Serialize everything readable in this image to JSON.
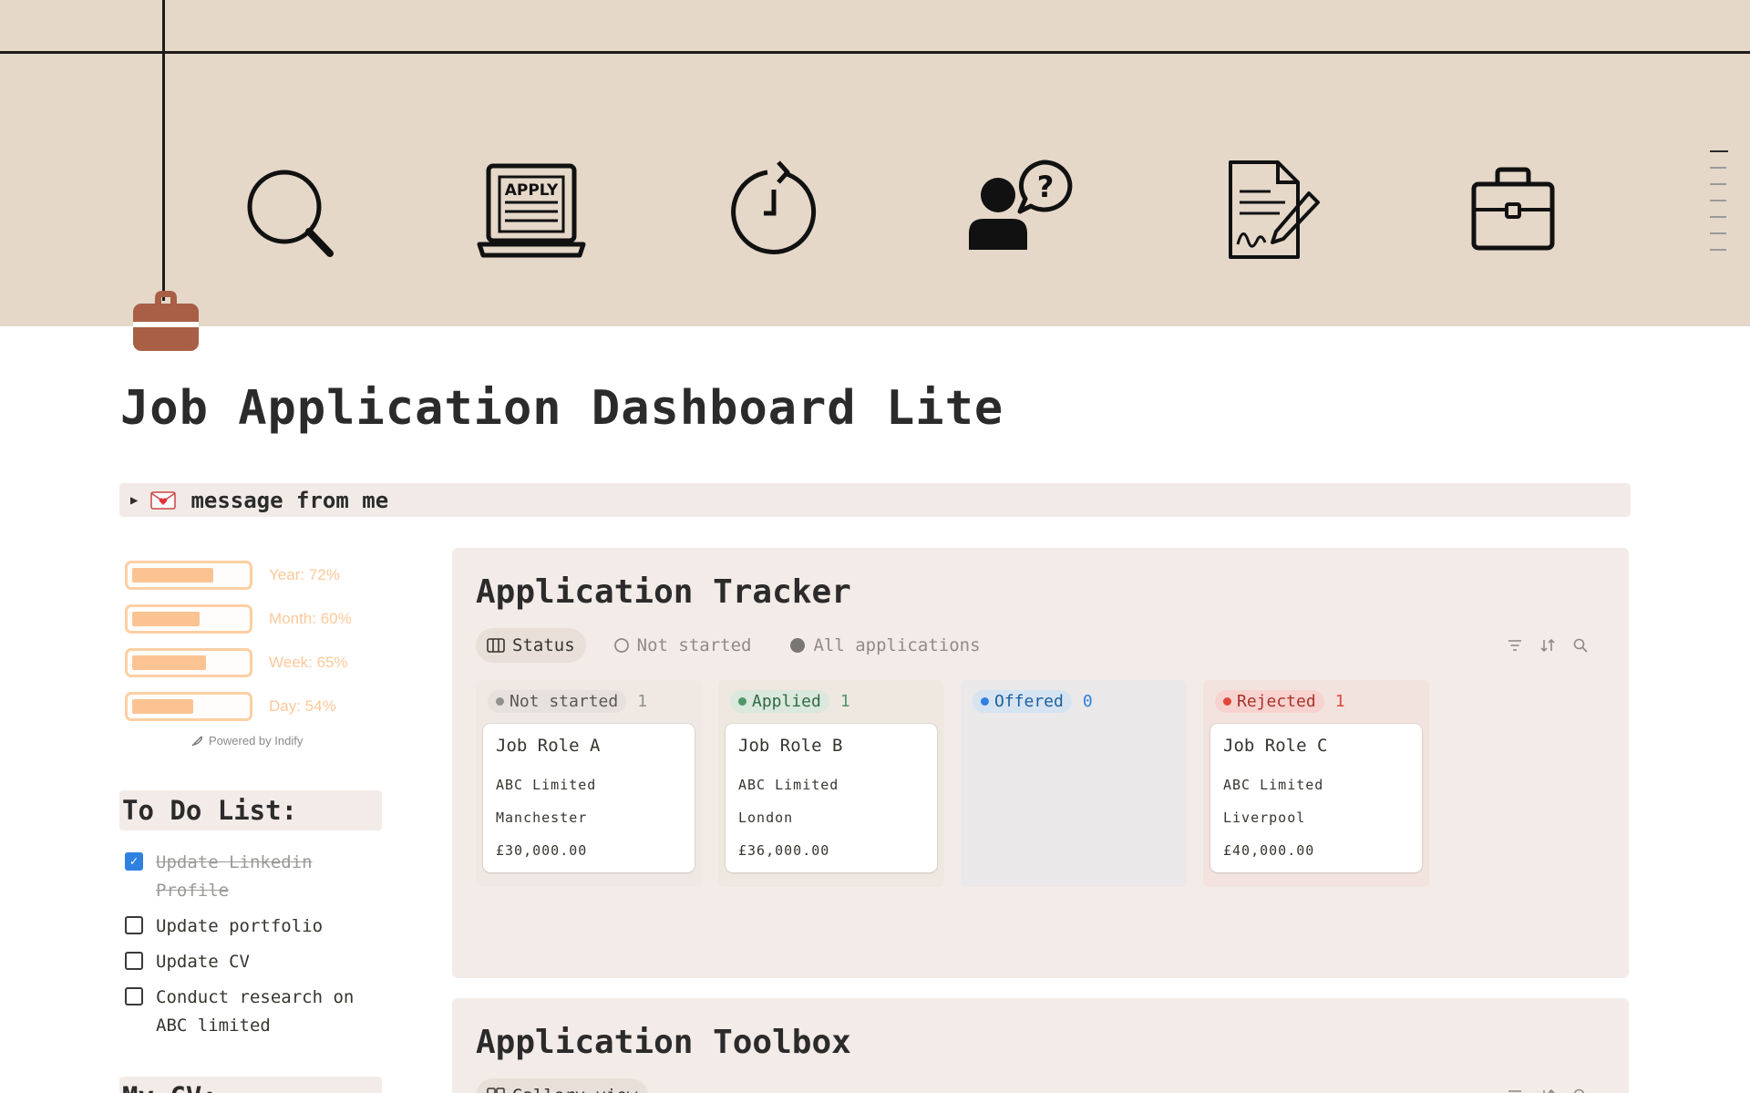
{
  "page": {
    "title": "Job Application Dashboard Lite",
    "toggle_label": "message from me"
  },
  "cover": {
    "background": "#e5d8c9",
    "icons": [
      "search-icon",
      "laptop-apply-icon",
      "clock-refresh-icon",
      "person-question-icon",
      "contract-sign-icon",
      "briefcase-icon"
    ],
    "apply_text": "APPLY"
  },
  "progress": {
    "bars": [
      {
        "label": "Year: 72%",
        "value": 0.72
      },
      {
        "label": "Month: 60%",
        "value": 0.6
      },
      {
        "label": "Week: 65%",
        "value": 0.65
      },
      {
        "label": "Day: 54%",
        "value": 0.54
      }
    ],
    "powered_by": "Powered by Indify",
    "color": "#fcc392"
  },
  "todo": {
    "heading": "To Do List:",
    "items": [
      {
        "text": "Update Linkedin Profile",
        "checked": true
      },
      {
        "text": "Update portfolio",
        "checked": false
      },
      {
        "text": "Update CV",
        "checked": false
      },
      {
        "text": "Conduct research on ABC limited",
        "checked": false
      }
    ]
  },
  "cv": {
    "heading": "My CV:"
  },
  "tracker": {
    "title": "Application Tracker",
    "views": [
      {
        "label": "Status",
        "active": true
      },
      {
        "label": "Not started",
        "active": false
      },
      {
        "label": "All applications",
        "active": false
      }
    ],
    "columns": [
      {
        "status": "Not started",
        "count": "1",
        "pill_bg": "#e6e1dd",
        "dot": "#91918e",
        "text": "#5a5855",
        "col_bg": "#efe8e3",
        "cards": [
          {
            "title": "Job Role A",
            "company": "ABC Limited",
            "location": "Manchester",
            "salary": "£30,000.00"
          }
        ]
      },
      {
        "status": "Applied",
        "count": "1",
        "pill_bg": "#dbe8dd",
        "dot": "#4f9768",
        "text": "#2f6b46",
        "col_bg": "#eee8e1",
        "cards": [
          {
            "title": "Job Role B",
            "company": "ABC Limited",
            "location": "London",
            "salary": "£36,000.00"
          }
        ]
      },
      {
        "status": "Offered",
        "count": "0",
        "pill_bg": "#d6e4f2",
        "dot": "#2f80e0",
        "text": "#1f5f9f",
        "col_bg": "#ebe8e9",
        "cards": []
      },
      {
        "status": "Rejected",
        "count": "1",
        "pill_bg": "#f7d3cf",
        "dot": "#e0483c",
        "text": "#a9322b",
        "col_bg": "#f3e3df",
        "cards": [
          {
            "title": "Job Role C",
            "company": "ABC Limited",
            "location": "Liverpool",
            "salary": "£40,000.00"
          }
        ]
      }
    ]
  },
  "toolbox": {
    "title": "Application Toolbox",
    "view_label": "Gallery view"
  }
}
